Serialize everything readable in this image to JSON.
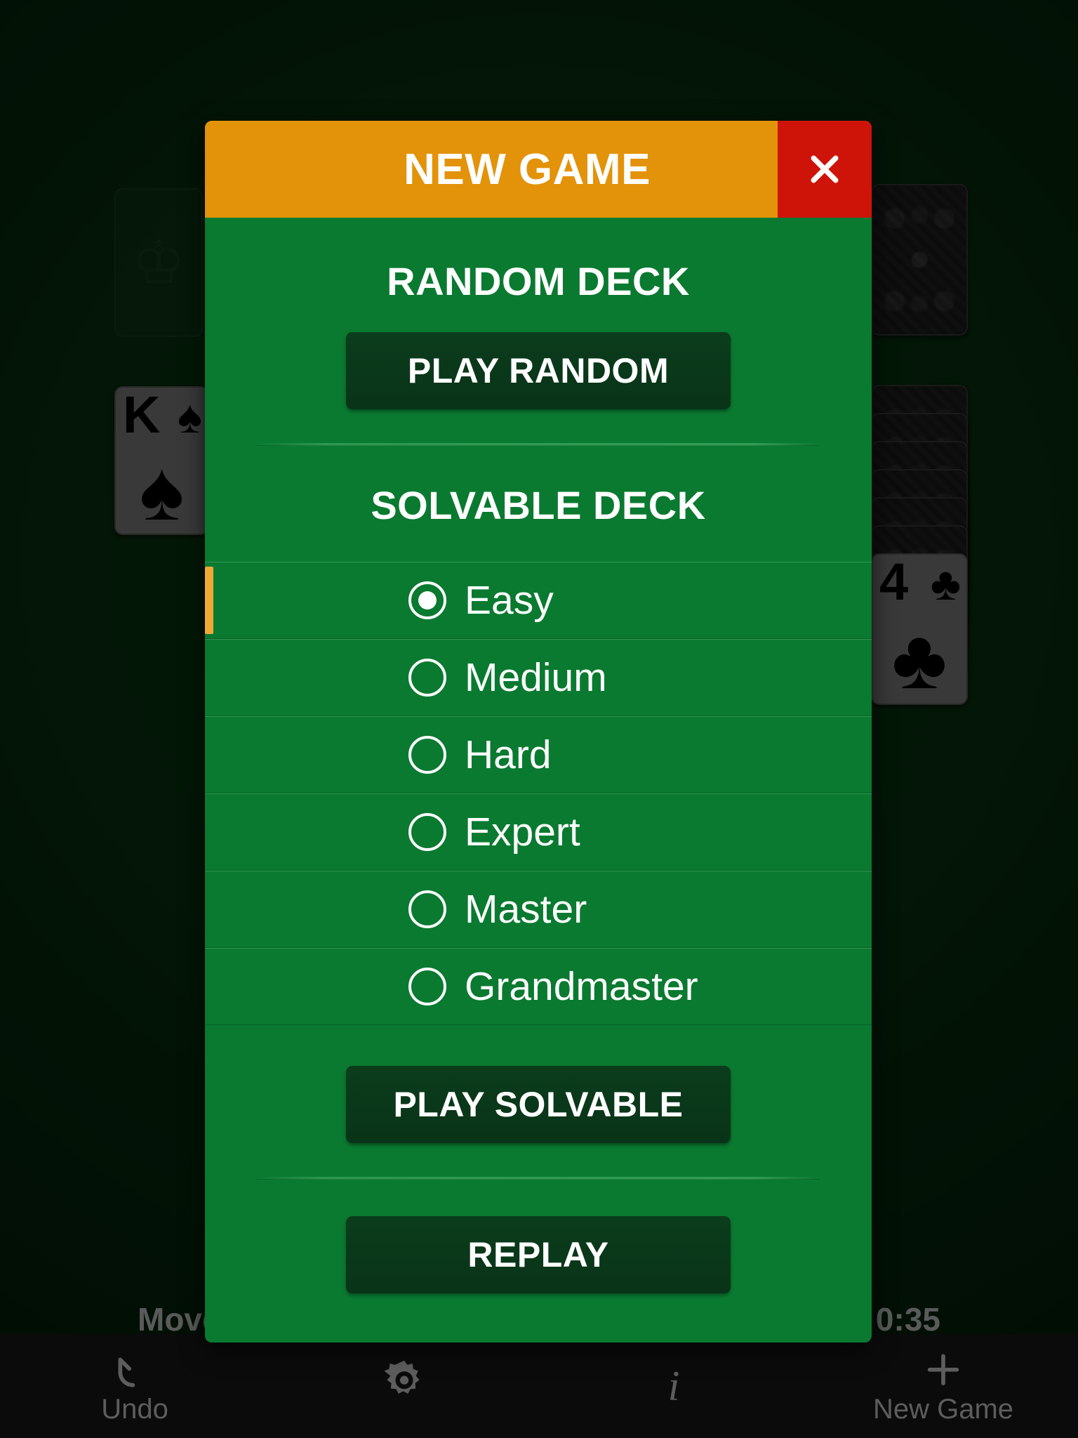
{
  "dialog": {
    "title": "NEW GAME",
    "close_icon": "close-icon",
    "random_section": {
      "heading": "RANDOM DECK",
      "play_button": "PLAY RANDOM"
    },
    "solvable_section": {
      "heading": "SOLVABLE DECK",
      "options": [
        {
          "label": "Easy",
          "selected": true
        },
        {
          "label": "Medium",
          "selected": false
        },
        {
          "label": "Hard",
          "selected": false
        },
        {
          "label": "Expert",
          "selected": false
        },
        {
          "label": "Master",
          "selected": false
        },
        {
          "label": "Grandmaster",
          "selected": false
        }
      ],
      "play_button": "PLAY SOLVABLE"
    },
    "replay_button": "REPLAY"
  },
  "status": {
    "moves_label": "Moves",
    "time": "0:35"
  },
  "toolbar": [
    {
      "label": "Undo",
      "icon": "undo-icon"
    },
    {
      "label": "",
      "icon": "gear-icon"
    },
    {
      "label": "",
      "icon": "info-icon"
    },
    {
      "label": "New Game",
      "icon": "plus-icon"
    }
  ],
  "table": {
    "cards": [
      {
        "name": "king-of-spades",
        "rank": "K",
        "suit": "♠"
      },
      {
        "name": "four-of-clubs",
        "rank": "4",
        "suit": "♣"
      }
    ],
    "foundation_placeholder_icon": "crown-icon"
  },
  "colors": {
    "header_orange": "#e3930a",
    "close_red": "#ce1408",
    "dialog_green": "#0a7a30",
    "button_dark_green": "#0b3d1c",
    "selection_amber": "#f0a836",
    "table_green": "#073010",
    "toolbar_black": "#0b0b0b"
  }
}
